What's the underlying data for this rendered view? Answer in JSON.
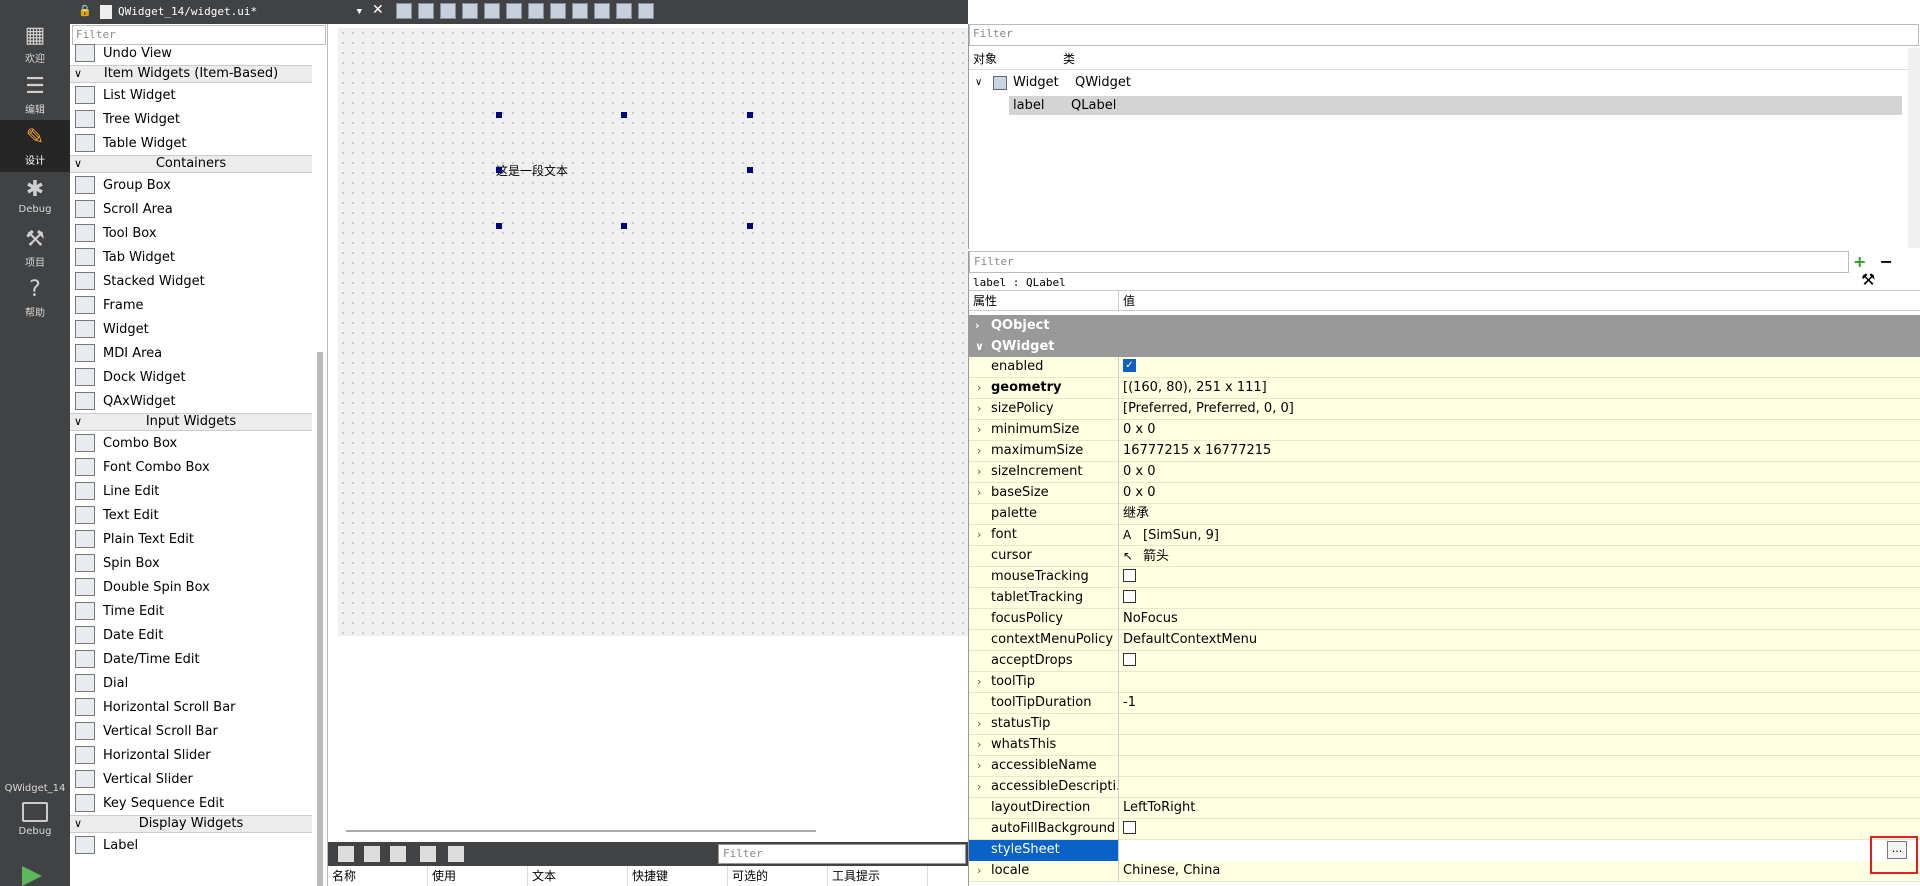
{
  "mode_bar": {
    "items": [
      {
        "label": "欢迎",
        "icon": "grid-icon"
      },
      {
        "label": "编辑",
        "icon": "edit-document-icon"
      },
      {
        "label": "设计",
        "icon": "pencil-icon"
      },
      {
        "label": "Debug",
        "icon": "bug-icon"
      },
      {
        "label": "项目",
        "icon": "wrench-icon"
      },
      {
        "label": "帮助",
        "icon": "help-icon"
      }
    ],
    "project_name": "QWidget_14",
    "project_mode": "Debug"
  },
  "document": {
    "title": "QWidget_14/widget.ui*"
  },
  "widget_box": {
    "filter_placeholder": "Filter",
    "items": [
      {
        "type": "item",
        "label": "Undo View"
      },
      {
        "type": "category",
        "label": "Item Widgets (Item-Based)"
      },
      {
        "type": "item",
        "label": "List Widget"
      },
      {
        "type": "item",
        "label": "Tree Widget"
      },
      {
        "type": "item",
        "label": "Table Widget"
      },
      {
        "type": "category",
        "label": "Containers"
      },
      {
        "type": "item",
        "label": "Group Box"
      },
      {
        "type": "item",
        "label": "Scroll Area"
      },
      {
        "type": "item",
        "label": "Tool Box"
      },
      {
        "type": "item",
        "label": "Tab Widget"
      },
      {
        "type": "item",
        "label": "Stacked Widget"
      },
      {
        "type": "item",
        "label": "Frame"
      },
      {
        "type": "item",
        "label": "Widget"
      },
      {
        "type": "item",
        "label": "MDI Area"
      },
      {
        "type": "item",
        "label": "Dock Widget"
      },
      {
        "type": "item",
        "label": "QAxWidget"
      },
      {
        "type": "category",
        "label": "Input Widgets"
      },
      {
        "type": "item",
        "label": "Combo Box"
      },
      {
        "type": "item",
        "label": "Font Combo Box"
      },
      {
        "type": "item",
        "label": "Line Edit"
      },
      {
        "type": "item",
        "label": "Text Edit"
      },
      {
        "type": "item",
        "label": "Plain Text Edit"
      },
      {
        "type": "item",
        "label": "Spin Box"
      },
      {
        "type": "item",
        "label": "Double Spin Box"
      },
      {
        "type": "item",
        "label": "Time Edit"
      },
      {
        "type": "item",
        "label": "Date Edit"
      },
      {
        "type": "item",
        "label": "Date/Time Edit"
      },
      {
        "type": "item",
        "label": "Dial"
      },
      {
        "type": "item",
        "label": "Horizontal Scroll Bar"
      },
      {
        "type": "item",
        "label": "Vertical Scroll Bar"
      },
      {
        "type": "item",
        "label": "Horizontal Slider"
      },
      {
        "type": "item",
        "label": "Vertical Slider"
      },
      {
        "type": "item",
        "label": "Key Sequence Edit"
      },
      {
        "type": "category",
        "label": "Display Widgets"
      },
      {
        "type": "item",
        "label": "Label"
      }
    ]
  },
  "form": {
    "label_text": "这是一段文本"
  },
  "action_editor": {
    "filter_placeholder": "Filter",
    "columns": [
      "名称",
      "使用",
      "文本",
      "快捷键",
      "可选的",
      "工具提示"
    ]
  },
  "object_inspector": {
    "filter_placeholder": "Filter",
    "col_object": "对象",
    "col_class": "类",
    "rows": [
      {
        "object": "Widget",
        "class": "QWidget"
      },
      {
        "object": "label",
        "class": "QLabel"
      }
    ]
  },
  "property_editor": {
    "filter_placeholder": "Filter",
    "title": "label : QLabel",
    "col_property": "属性",
    "col_value": "值",
    "groups": {
      "qobject": "QObject",
      "qwidget": "QWidget"
    },
    "properties": [
      {
        "name": "enabled",
        "value": "",
        "checkbox": true,
        "checked": true
      },
      {
        "name": "geometry",
        "value": "[(160, 80), 251 x 111]",
        "expandable": true,
        "bold": true
      },
      {
        "name": "sizePolicy",
        "value": "[Preferred, Preferred, 0, 0]",
        "expandable": true
      },
      {
        "name": "minimumSize",
        "value": "0 x 0",
        "expandable": true
      },
      {
        "name": "maximumSize",
        "value": "16777215 x 16777215",
        "expandable": true
      },
      {
        "name": "sizeIncrement",
        "value": "0 x 0",
        "expandable": true
      },
      {
        "name": "baseSize",
        "value": "0 x 0",
        "expandable": true
      },
      {
        "name": "palette",
        "value": "继承"
      },
      {
        "name": "font",
        "value": "[SimSun, 9]",
        "expandable": true,
        "icon": "font-icon"
      },
      {
        "name": "cursor",
        "value": "箭头",
        "icon": "cursor-arrow-icon"
      },
      {
        "name": "mouseTracking",
        "value": "",
        "checkbox": true,
        "checked": false
      },
      {
        "name": "tabletTracking",
        "value": "",
        "checkbox": true,
        "checked": false
      },
      {
        "name": "focusPolicy",
        "value": "NoFocus"
      },
      {
        "name": "contextMenuPolicy",
        "value": "DefaultContextMenu"
      },
      {
        "name": "acceptDrops",
        "value": "",
        "checkbox": true,
        "checked": false
      },
      {
        "name": "toolTip",
        "value": "",
        "expandable": true
      },
      {
        "name": "toolTipDuration",
        "value": "-1"
      },
      {
        "name": "statusTip",
        "value": "",
        "expandable": true
      },
      {
        "name": "whatsThis",
        "value": "",
        "expandable": true
      },
      {
        "name": "accessibleName",
        "value": "",
        "expandable": true
      },
      {
        "name": "accessibleDescripti...",
        "value": "",
        "expandable": true
      },
      {
        "name": "layoutDirection",
        "value": "LeftToRight"
      },
      {
        "name": "autoFillBackground",
        "value": "",
        "checkbox": true,
        "checked": false
      },
      {
        "name": "styleSheet",
        "value": "",
        "selected": true,
        "edit_button": "..."
      },
      {
        "name": "locale",
        "value": "Chinese, China",
        "expandable": true
      }
    ]
  },
  "colors": {
    "selection": "#0a62c9",
    "property_bg": "#ffffe1",
    "mode_bar_bg": "#404244",
    "highlight_box": "#e02020"
  }
}
